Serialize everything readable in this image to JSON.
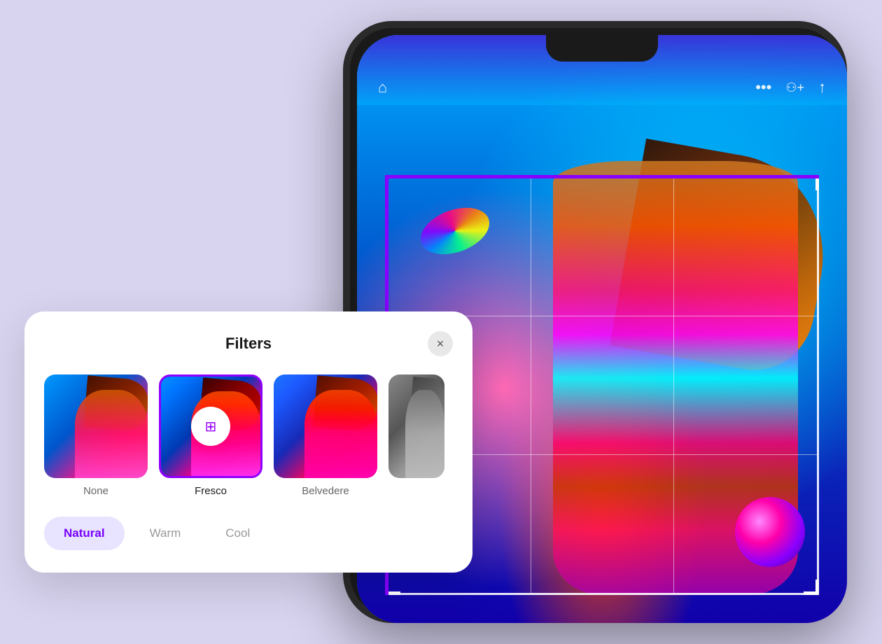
{
  "background_color": "#d8d4f0",
  "phone": {
    "nav": {
      "home_icon": "⌂",
      "more_icon": "•••",
      "add_friends_icon": "👥",
      "share_icon": "↑"
    }
  },
  "filters_panel": {
    "title": "Filters",
    "close_label": "×",
    "thumbnails": [
      {
        "id": "none",
        "label": "None",
        "active": false
      },
      {
        "id": "fresco",
        "label": "Fresco",
        "active": true
      },
      {
        "id": "belvedere",
        "label": "Belvedere",
        "active": false
      },
      {
        "id": "fourth",
        "label": "",
        "active": false
      }
    ],
    "tones": [
      {
        "id": "natural",
        "label": "Natural",
        "active": true
      },
      {
        "id": "warm",
        "label": "Warm",
        "active": false
      },
      {
        "id": "cool",
        "label": "Cool",
        "active": false
      }
    ]
  }
}
